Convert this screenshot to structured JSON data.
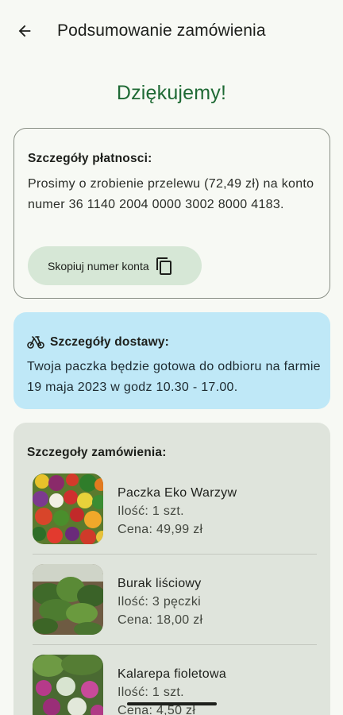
{
  "appbar": {
    "title": "Podsumowanie zamówienia",
    "back_icon": "arrow-left-icon"
  },
  "thanks": "Dziękujemy!",
  "payment": {
    "title": "Szczegóły płatnosci:",
    "text": "Prosimy o zrobienie przelewu (72,49 zł) na konto numer 36 1140 2004 0000 3002 8000 4183.",
    "copy_button_label": "Skopiuj numer konta",
    "copy_icon": "copy-icon",
    "button_color": "#d6e7d6"
  },
  "delivery": {
    "title": "Szczegóły dostawy:",
    "icon": "cargo-bike-icon",
    "text": "Twoja paczka będzie gotowa do odbioru na farmie 19 maja 2023 w godz 10.30 - 17.00.",
    "background": "#bfe8f7"
  },
  "order": {
    "title": "Szczegoły zamówienia:",
    "items": [
      {
        "name": "Paczka Eko Warzyw",
        "qty": "Ilość: 1 szt.",
        "price": "Cena: 49,99 zł"
      },
      {
        "name": "Burak liściowy",
        "qty": "Ilość: 3 pęczki",
        "price": "Cena: 18,00 zł"
      },
      {
        "name": "Kalarepa fioletowa",
        "qty": "Ilość: 1 szt.",
        "price": "Cena: 4,50 zł"
      }
    ]
  },
  "colors": {
    "accent_green": "#1f6a35",
    "background": "#f7f9f4",
    "order_card": "#dfe4dc"
  }
}
